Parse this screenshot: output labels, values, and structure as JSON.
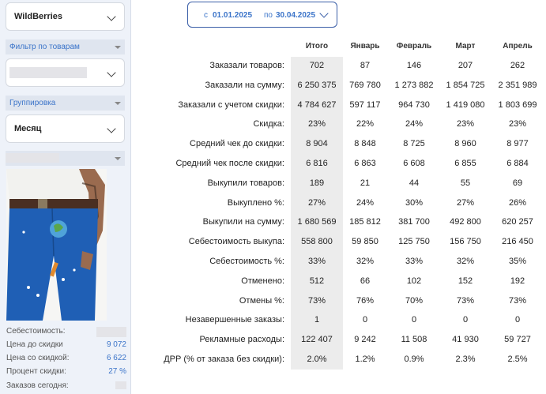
{
  "sidebar": {
    "store_select": {
      "value": "WildBerries"
    },
    "filter_header": {
      "label": "Фильтр по товарам"
    },
    "grouping_header": {
      "label": "Группировка"
    },
    "grouping_select": {
      "value": "Месяц"
    },
    "stats": [
      {
        "label": "Себестоимость:",
        "value": ""
      },
      {
        "label": "Цена до скидки",
        "value": "9 072"
      },
      {
        "label": "Цена со скидкой:",
        "value": "6 622"
      },
      {
        "label": "Процент скидки:",
        "value": "27 %"
      },
      {
        "label": "Заказов сегодня:",
        "value": ""
      }
    ]
  },
  "date_range": {
    "from_prefix": "с",
    "from": "01.01.2025",
    "to_prefix": "по",
    "to": "30.04.2025"
  },
  "table": {
    "columns": [
      "Итого",
      "Январь",
      "Февраль",
      "Март",
      "Апрель"
    ],
    "rows": [
      {
        "label": "Заказали товаров:",
        "values": [
          "702",
          "87",
          "146",
          "207",
          "262"
        ]
      },
      {
        "label": "Заказали на сумму:",
        "values": [
          "6 250 375",
          "769 780",
          "1 273 882",
          "1 854 725",
          "2 351 989"
        ]
      },
      {
        "label": "Заказали с учетом скидки:",
        "values": [
          "4 784 627",
          "597 117",
          "964 730",
          "1 419 080",
          "1 803 699"
        ]
      },
      {
        "label": "Скидка:",
        "values": [
          "23%",
          "22%",
          "24%",
          "23%",
          "23%"
        ]
      },
      {
        "label": "Средний чек до скидки:",
        "values": [
          "8 904",
          "8 848",
          "8 725",
          "8 960",
          "8 977"
        ]
      },
      {
        "label": "Средний чек после скидки:",
        "values": [
          "6 816",
          "6 863",
          "6 608",
          "6 855",
          "6 884"
        ]
      },
      {
        "label": "Выкупили товаров:",
        "values": [
          "189",
          "21",
          "44",
          "55",
          "69"
        ]
      },
      {
        "label": "Выкуплено %:",
        "values": [
          "27%",
          "24%",
          "30%",
          "27%",
          "26%"
        ]
      },
      {
        "label": "Выкупили на сумму:",
        "values": [
          "1 680 569",
          "185 812",
          "381 700",
          "492 800",
          "620 257"
        ]
      },
      {
        "label": "Себестоимость выкупа:",
        "values": [
          "558 800",
          "59 850",
          "125 750",
          "156 750",
          "216 450"
        ]
      },
      {
        "label": "Себестоимость %:",
        "values": [
          "33%",
          "32%",
          "33%",
          "32%",
          "35%"
        ]
      },
      {
        "label": "Отменено:",
        "values": [
          "512",
          "66",
          "102",
          "152",
          "192"
        ]
      },
      {
        "label": "Отмены %:",
        "values": [
          "73%",
          "76%",
          "70%",
          "73%",
          "73%"
        ]
      },
      {
        "label": "Незавершенные заказы:",
        "values": [
          "1",
          "0",
          "0",
          "0",
          "0"
        ]
      },
      {
        "label": "Рекламные расходы:",
        "values": [
          "122 407",
          "9 242",
          "11 508",
          "41 930",
          "59 727"
        ]
      },
      {
        "label": "ДРР (% от заказа без скидки):",
        "values": [
          "2.0%",
          "1.2%",
          "0.9%",
          "2.3%",
          "2.5%"
        ]
      }
    ]
  }
}
